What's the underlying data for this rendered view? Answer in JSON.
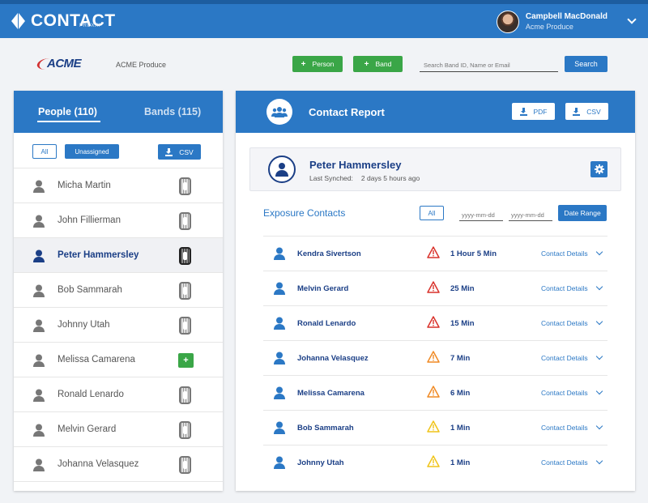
{
  "app": {
    "logo_text": "CONTACT",
    "logo_sub": "PROXXI",
    "user_name": "Campbell MacDonald",
    "user_org": "Acme Produce"
  },
  "subheader": {
    "acme_logo": "ACME",
    "org_name": "ACME Produce",
    "add_person": "Person",
    "add_band": "Band",
    "search_placeholder": "Search Band ID, Name or Email",
    "search_button": "Search"
  },
  "left_panel": {
    "tab_people": "People (110)",
    "tab_bands": "Bands (115)",
    "filter_all": "All",
    "filter_unassigned": "Unassigned",
    "csv_button": "CSV",
    "people": [
      {
        "name": "Micha Martin",
        "band": "assigned"
      },
      {
        "name": "John Fillierman",
        "band": "assigned"
      },
      {
        "name": "Peter Hammersley",
        "band": "assigned",
        "selected": true
      },
      {
        "name": "Bob Sammarah",
        "band": "assigned"
      },
      {
        "name": "Johnny Utah",
        "band": "assigned"
      },
      {
        "name": "Melissa Camarena",
        "band": "add",
        "add_label": "+"
      },
      {
        "name": "Ronald Lenardo",
        "band": "assigned"
      },
      {
        "name": "Melvin Gerard",
        "band": "assigned"
      },
      {
        "name": "Johanna Velasquez",
        "band": "assigned"
      }
    ]
  },
  "report": {
    "title": "Contact Report",
    "pdf_button": "PDF",
    "csv_button": "CSV",
    "profile_name": "Peter Hammersley",
    "last_synched_label": "Last Synched:",
    "last_synched_value": "2 days 5 hours ago",
    "exposure_title": "Exposure Contacts",
    "filter_all": "All",
    "date_placeholder": "yyyy-mm-dd",
    "date_range_button": "Date Range",
    "details_label": "Contact Details",
    "contacts": [
      {
        "name": "Kendra Sivertson",
        "duration": "1 Hour 5 Min",
        "severity": "high"
      },
      {
        "name": "Melvin Gerard",
        "duration": "25 Min",
        "severity": "high"
      },
      {
        "name": "Ronald Lenardo",
        "duration": "15 Min",
        "severity": "high"
      },
      {
        "name": "Johanna Velasquez",
        "duration": "7 Min",
        "severity": "medium"
      },
      {
        "name": "Melissa Camarena",
        "duration": "6 Min",
        "severity": "medium"
      },
      {
        "name": "Bob Sammarah",
        "duration": "1 Min",
        "severity": "low"
      },
      {
        "name": "Johnny Utah",
        "duration": "1 Min",
        "severity": "low"
      }
    ]
  },
  "colors": {
    "primary": "#2b78c5",
    "navy": "#1b3f86",
    "green": "#3aa647",
    "severity_high": "#d9322b",
    "severity_medium": "#f08a24",
    "severity_low": "#f0c419"
  }
}
